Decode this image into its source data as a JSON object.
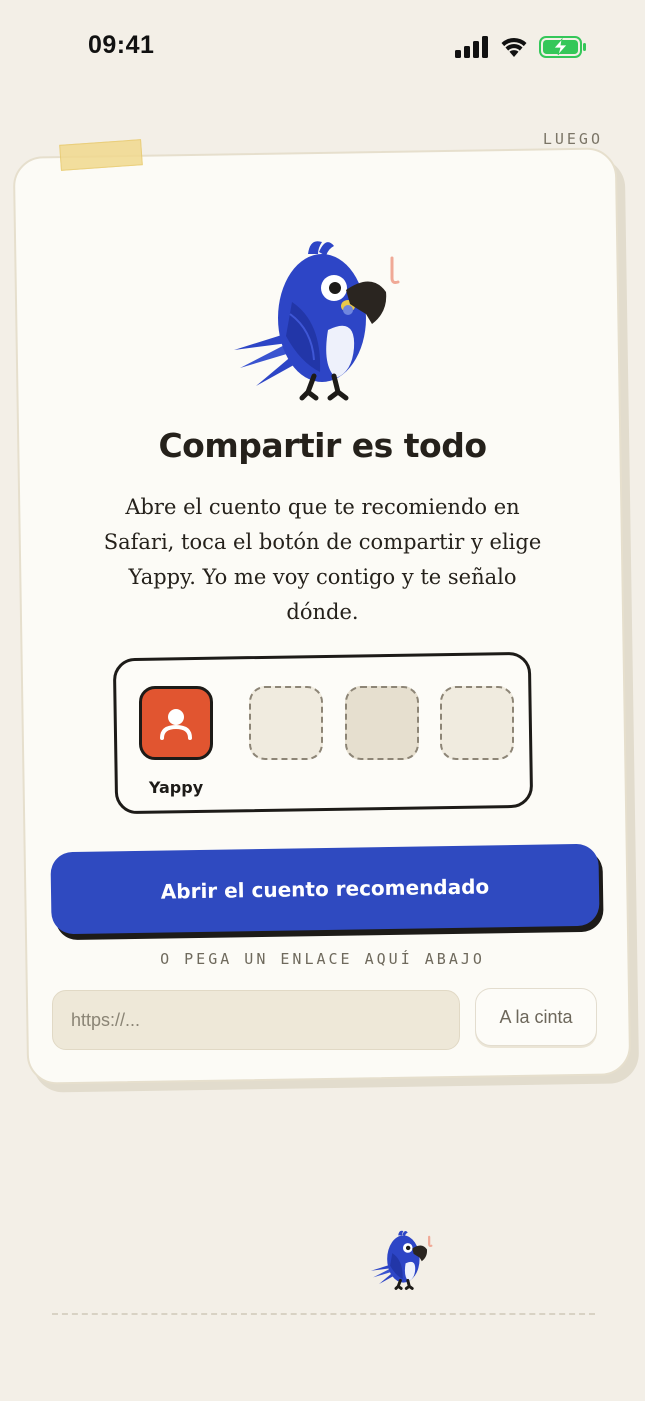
{
  "status_bar": {
    "time": "09:41"
  },
  "header": {
    "skip_label": "LUEGO"
  },
  "onboarding": {
    "title": "Compartir es todo",
    "description": "Abre el cuento que te recomiendo en Safari, toca el botón de compartir y elige Yappy. Yo me voy contigo y te señalo dónde.",
    "share_sheet": {
      "app_label": "Yappy"
    },
    "cta_label": "Abrir el cuento recomendado",
    "paste_hint": "O PEGA UN ENLACE AQUÍ ABAJO",
    "url_input": {
      "value": "",
      "placeholder": "https://..."
    },
    "tape_button_label": "A la cinta"
  },
  "colors": {
    "background": "#f3efe7",
    "card": "#fcfbf6",
    "accent_blue": "#2f4ac0",
    "app_tile": "#e15530",
    "battery": "#34c759"
  },
  "icons": [
    "signal-icon",
    "wifi-icon",
    "battery-charging-icon",
    "parrot-mascot-icon",
    "user-icon"
  ]
}
